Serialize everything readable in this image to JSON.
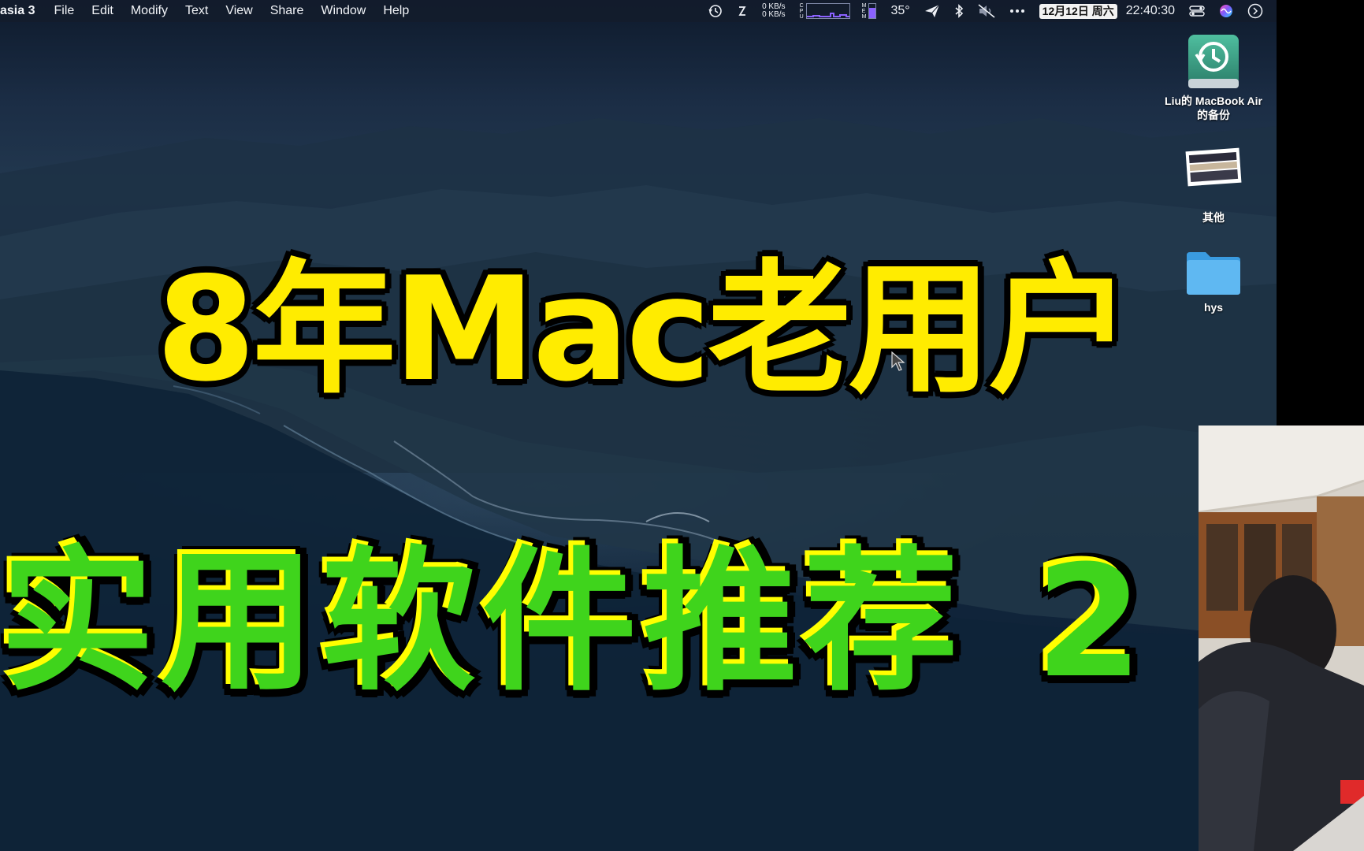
{
  "menubar": {
    "app_name": "asia 3",
    "menus": [
      "File",
      "Edit",
      "Modify",
      "Text",
      "View",
      "Share",
      "Window",
      "Help"
    ],
    "status": {
      "net_up": "0 KB/s",
      "net_down": "0 KB/s",
      "cpu_label": [
        "C",
        "P",
        "U"
      ],
      "mem_label": [
        "M",
        "E",
        "M"
      ],
      "temperature": "35°",
      "date": "12月12日 周六",
      "time": "22:40:30"
    },
    "icons": [
      "time-machine-icon",
      "sync-icon",
      "paper-plane-icon",
      "bluetooth-icon",
      "mute-icon",
      "more-icon",
      "control-center-icon",
      "siri-icon",
      "clock-icon"
    ]
  },
  "desktop_icons": [
    {
      "label_line1": "Liu的 MacBook Air",
      "label_line2": "的备份",
      "icon": "time-machine-drive-icon"
    },
    {
      "label_line1": "其他",
      "label_line2": "",
      "icon": "screenshot-thumbnail-icon"
    },
    {
      "label_line1": "hys",
      "label_line2": "",
      "icon": "folder-icon"
    }
  ],
  "overlay": {
    "title_line1": "8年Mac老用户",
    "title_line2": "实用软件推荐",
    "title_number": "2"
  },
  "colors": {
    "title_yellow": "#ffec00",
    "title_green": "#3fd41c",
    "menubar_bg": "#141c2c"
  }
}
